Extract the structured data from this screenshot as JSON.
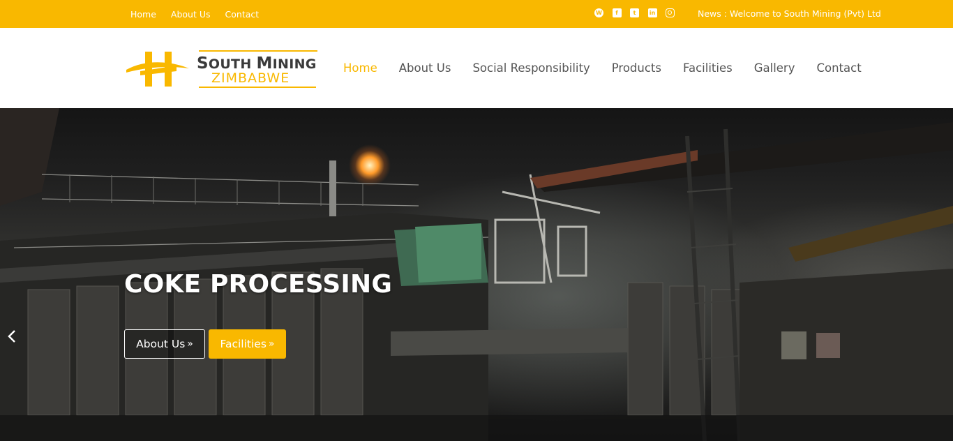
{
  "topbar": {
    "links": [
      "Home",
      "About Us",
      "Contact"
    ],
    "social_icons": [
      "wordpress-icon",
      "facebook-icon",
      "twitter-icon",
      "linkedin-icon",
      "instagram-icon"
    ],
    "news": "News : Welcome to South Mining (Pvt) Ltd",
    "background_color": "#f9b800"
  },
  "logo": {
    "line1_big1": "S",
    "line1_small1": "OUTH ",
    "line1_big2": "M",
    "line1_small2": "INING",
    "line2": "ZIMBABWE"
  },
  "nav": {
    "items": [
      {
        "label": "Home",
        "active": true
      },
      {
        "label": "About Us",
        "active": false
      },
      {
        "label": "Social Responsibility",
        "active": false
      },
      {
        "label": "Products",
        "active": false
      },
      {
        "label": "Facilities",
        "active": false
      },
      {
        "label": "Gallery",
        "active": false
      },
      {
        "label": "Contact",
        "active": false
      }
    ],
    "active_color": "#f9b800"
  },
  "hero": {
    "title": "COKE PROCESSING",
    "buttons": [
      {
        "label": "About Us",
        "icon": "double-chevron-right-icon"
      },
      {
        "label": "Facilities",
        "icon": "double-chevron-right-icon"
      }
    ],
    "prev_icon": "chevron-left-icon"
  }
}
